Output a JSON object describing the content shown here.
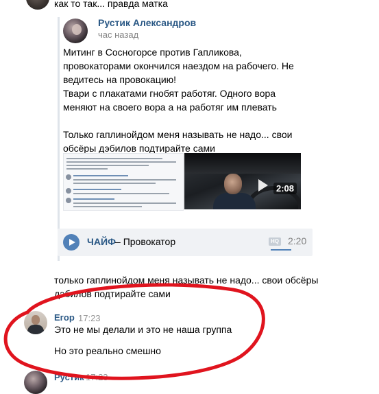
{
  "top_comment": {
    "text": "как то так... правда матка"
  },
  "repost": {
    "author": "Рустик Александров",
    "time": "час назад",
    "paragraphs": [
      "Митинг в Сосногорсе против Гапликова, провокаторами окончился наездом на рабочего. Не ведитесь на провокацию!",
      "Твари с плакатами гнобят работяг. Одного вора меняют на своего вора а на работяг им плевать",
      "",
      "Только гаплинойдом меня называть не надо... свои обсёры дэбилов подтирайте сами"
    ],
    "video": {
      "duration": "2:08"
    },
    "audio": {
      "artist": "ЧАЙФ",
      "separator": "–",
      "title": "Провокатор",
      "hq": "HQ",
      "duration": "2:20",
      "progress": 0.25
    }
  },
  "comment": {
    "text": "только гаплинойдом меня называть не надо... свои обсёры дэбилов подтирайте сами"
  },
  "reply": {
    "author": "Егор",
    "time": "17:23",
    "line1": "Это не мы делали и это не наша группа",
    "line2": "Но это реально смешно"
  },
  "bottom": {
    "author": "Рустик",
    "time": "17:23"
  },
  "colors": {
    "link": "#2a5885",
    "accent": "#5181b8",
    "highlight": "#e0141e"
  }
}
